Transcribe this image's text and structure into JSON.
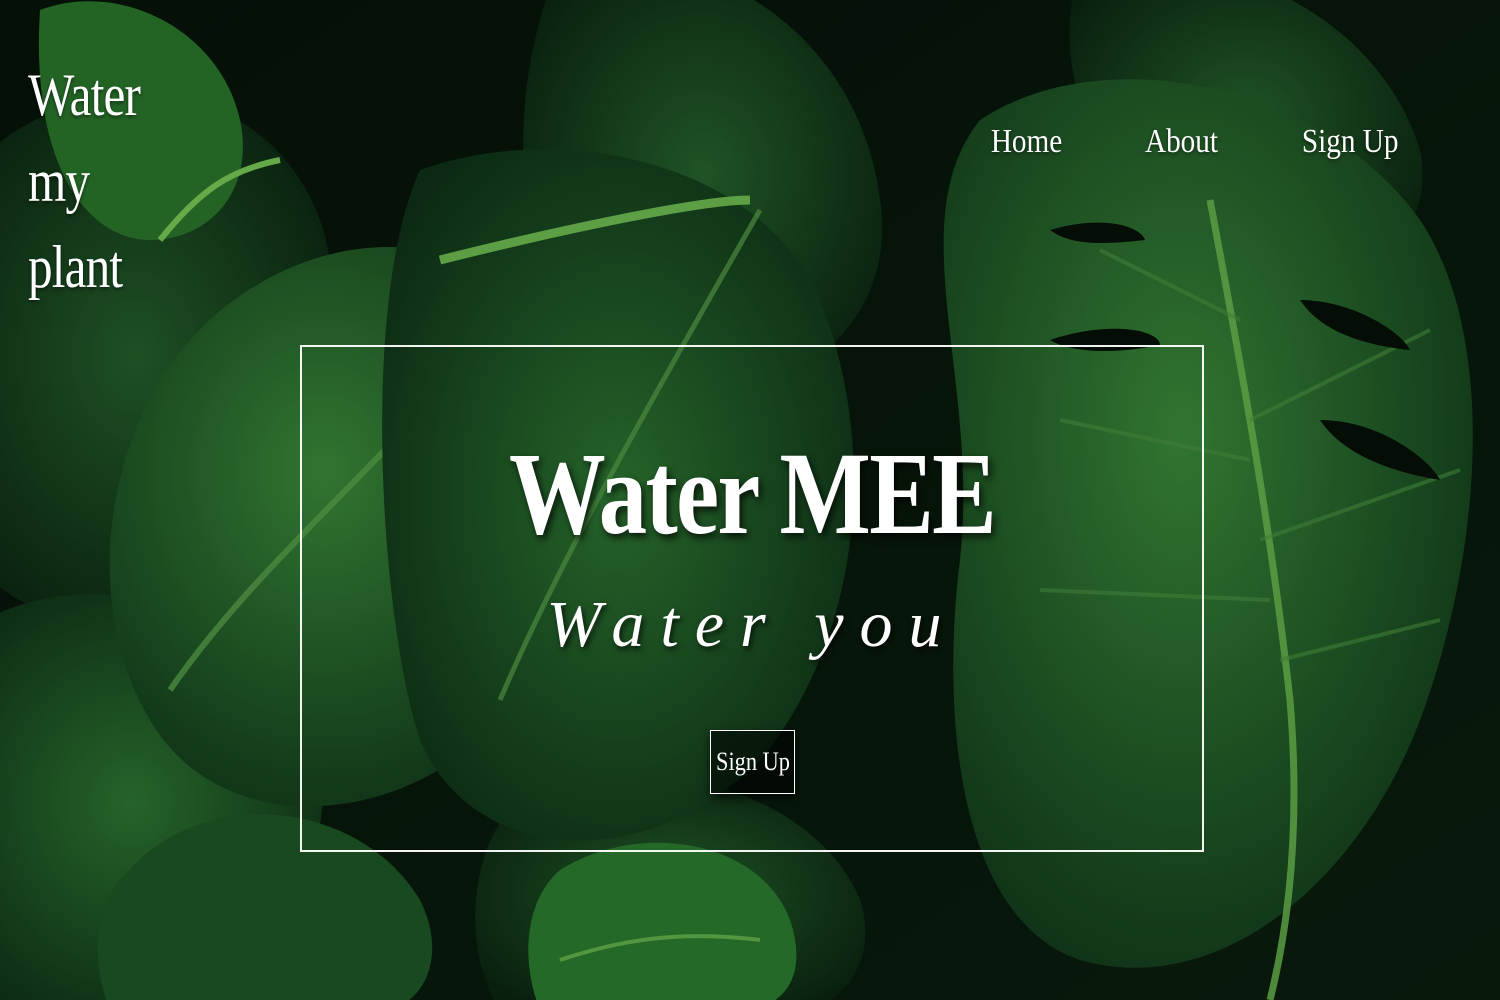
{
  "brand": {
    "line1": "Water",
    "line2": "my",
    "line3": "plant"
  },
  "nav": {
    "items": [
      {
        "label": "Home"
      },
      {
        "label": "About"
      },
      {
        "label": "Sign Up"
      }
    ]
  },
  "hero": {
    "title": "Water MEE",
    "subtitle": "Water you",
    "cta_label": "Sign Up"
  },
  "colors": {
    "text": "#ffffff",
    "leaf_dark": "#0d2414",
    "leaf_mid": "#1f5a2c",
    "leaf_light": "#3d8a3a"
  }
}
